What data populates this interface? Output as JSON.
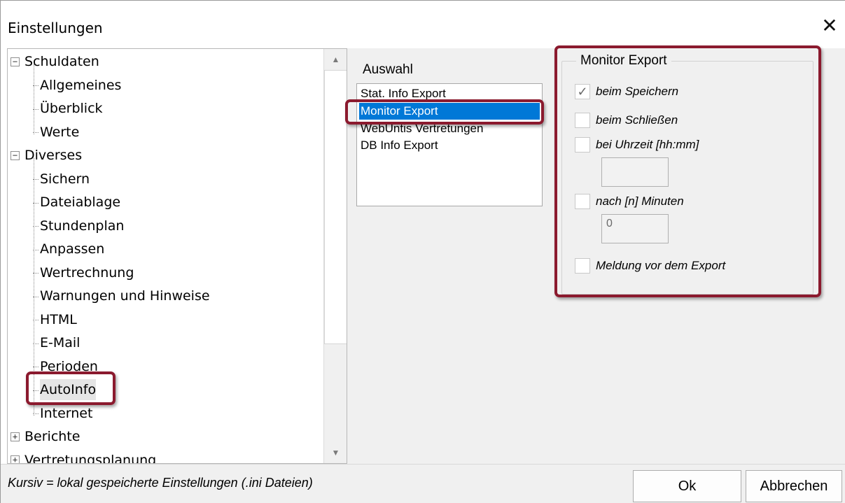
{
  "window": {
    "title": "Einstellungen",
    "close_glyph": "✕"
  },
  "tree": {
    "collapse_glyph": "−",
    "expand_glyph": "+",
    "groups": [
      {
        "label": "Schuldaten",
        "expanded": true,
        "children": [
          "Allgemeines",
          "Überblick",
          "Werte"
        ]
      },
      {
        "label": "Diverses",
        "expanded": true,
        "children": [
          "Sichern",
          "Dateiablage",
          "Stundenplan",
          "Anpassen",
          "Wertrechnung",
          "Warnungen und Hinweise",
          "HTML",
          "E-Mail",
          "Perioden",
          "AutoInfo",
          "Internet"
        ]
      },
      {
        "label": "Berichte",
        "expanded": false,
        "children": []
      },
      {
        "label": "Vertretungsplanung",
        "expanded": false,
        "children": []
      }
    ],
    "selected": "AutoInfo",
    "scroll_up_glyph": "▲",
    "scroll_down_glyph": "▼"
  },
  "auswahl": {
    "label": "Auswahl",
    "items": [
      "Stat. Info Export",
      "Monitor Export",
      "WebUntis Vertretungen",
      "DB Info Export"
    ],
    "selected": "Monitor Export"
  },
  "monitor_export": {
    "title": "Monitor Export",
    "beim_speichern": {
      "label": "beim Speichern",
      "checked": true,
      "check_glyph": "✓"
    },
    "beim_schliessen": {
      "label": "beim Schließen",
      "checked": false
    },
    "bei_uhrzeit": {
      "label": "bei Uhrzeit [hh:mm]",
      "checked": false,
      "value": ""
    },
    "nach_minuten": {
      "label": "nach [n] Minuten",
      "checked": false,
      "value": "0"
    },
    "meldung": {
      "label": "Meldung vor dem Export",
      "checked": false
    }
  },
  "footer": {
    "note": "Kursiv = lokal gespeicherte Einstellungen (.ini Dateien)",
    "ok_label": "Ok",
    "cancel_label": "Abbrechen"
  },
  "colors": {
    "selection": "#0078d7",
    "highlight": "#8b1a2e"
  }
}
